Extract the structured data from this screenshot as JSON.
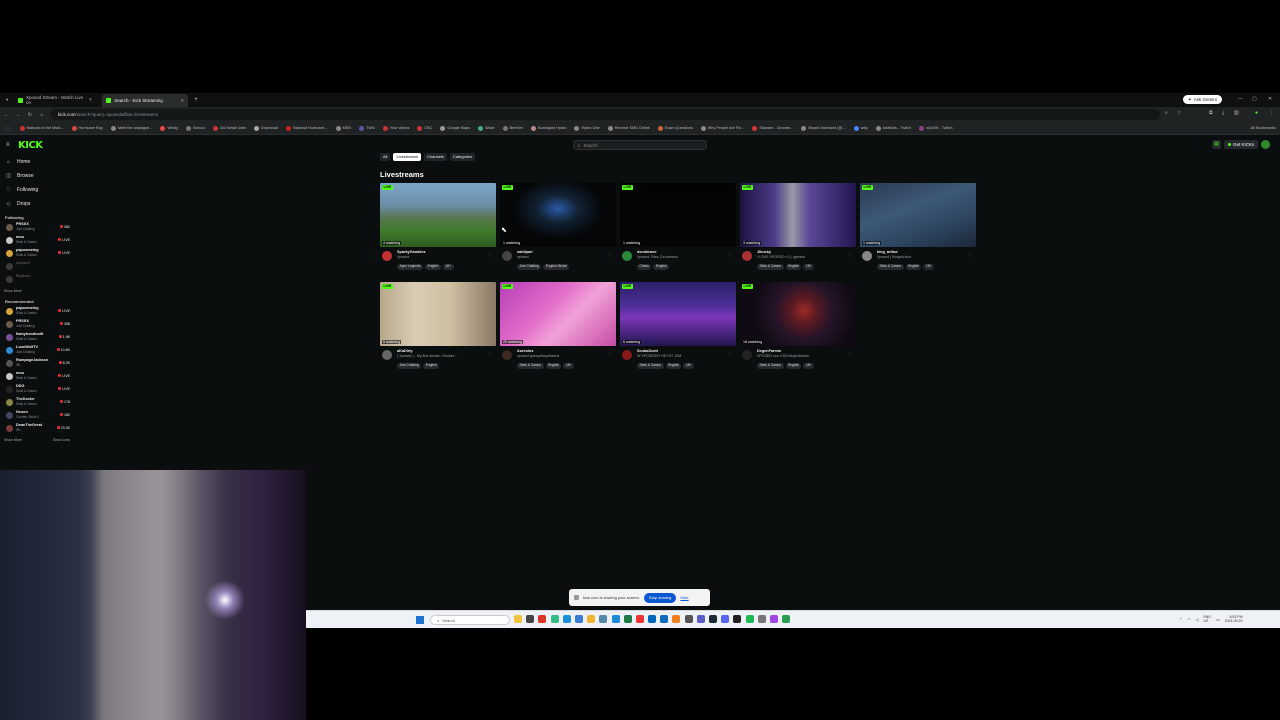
{
  "browser": {
    "tabs": [
      {
        "label": "Xposed Stream - Watch Live on"
      },
      {
        "label": "Search - Kick Streaming"
      }
    ],
    "ask_gemini": "Ask Gemini",
    "url_host": "kick.com",
    "url_path": "/search?query=xposed&filter=livestreams",
    "bookmarks": [
      "Malcolm in the Midd...",
      "Hurricane Ray",
      "Meet the analogue...",
      "Windy",
      "School",
      "444 Watch later",
      "Download",
      "National Hurricane...",
      "MSN",
      "TWN",
      "Your videos",
      "CBC",
      "Google Maps",
      "Waze",
      "BeeKen",
      "Burlington Hydro",
      "Hydro One",
      "Receive SMS Online",
      "Exam Questions",
      "Why People Are Fin...",
      "Shazam - Chrome...",
      "Bryant Moreland (@...",
      "wdq",
      "AdaBots - Twitch",
      "xQc0W - Twitch"
    ],
    "all_bookmarks": "All Bookmarks"
  },
  "kick": {
    "logo": "KICK",
    "search_placeholder": "Search",
    "get_kick": "Get KICKs",
    "sidebar": {
      "nav": [
        {
          "label": "Home",
          "icon": "home-icon"
        },
        {
          "label": "Browse",
          "icon": "browse-icon"
        },
        {
          "label": "Following",
          "icon": "heart-icon"
        },
        {
          "label": "Drops",
          "icon": "drops-icon"
        }
      ],
      "following_title": "Following",
      "following": [
        {
          "name": "PRSSX",
          "category": "Just Chatting",
          "viewers": "362",
          "color": "#6b5b4b",
          "offline": false
        },
        {
          "name": "moo",
          "category": "Slots & Casino",
          "viewers": "LIVE",
          "color": "#c9c9c9",
          "offline": false
        },
        {
          "name": "papoomeing",
          "category": "Slots & Casino",
          "viewers": "LIVE",
          "color": "#d9a23d",
          "offline": false
        },
        {
          "name": "Xposed",
          "category": "",
          "viewers": "",
          "color": "#3a3a3a",
          "offline": true
        },
        {
          "name": "Reptron",
          "category": "",
          "viewers": "",
          "color": "#3a3a3a",
          "offline": true
        }
      ],
      "show_more_following": "Show More",
      "recommended_title": "Recommended",
      "recommended": [
        {
          "name": "papoomeing",
          "category": "Slots & Casino",
          "viewers": "LIVE",
          "color": "#d9a23d"
        },
        {
          "name": "PRSSX",
          "category": "Just Chatting",
          "viewers": "358",
          "color": "#6b5b4b"
        },
        {
          "name": "flamyhoodnolit",
          "category": "Slots & Casino",
          "viewers": "1.9K",
          "color": "#7a4e9a"
        },
        {
          "name": "LoneWolfTV",
          "category": "Just Chatting",
          "viewers": "10.6K",
          "color": "#2e8bd6"
        },
        {
          "name": "RampageJackson",
          "category": "IRL",
          "viewers": "8.2K",
          "color": "#555"
        },
        {
          "name": "moo",
          "category": "Slots & Casino",
          "viewers": "LIVE",
          "color": "#c9c9c9"
        },
        {
          "name": "DDG",
          "category": "Slots & Casino",
          "viewers": "LIVE",
          "color": "#222"
        },
        {
          "name": "TheDocter",
          "category": "Slots & Casino",
          "viewers": "178",
          "color": "#884"
        },
        {
          "name": "Neoon",
          "category": "Counter-Strike 2",
          "viewers": "182",
          "color": "#446"
        },
        {
          "name": "DeanTheGreat",
          "category": "IRL",
          "viewers": "23.3K",
          "color": "#7a3b3b"
        }
      ],
      "show_more": "Show More",
      "show_less": "Show Less"
    },
    "filters": [
      {
        "label": "All",
        "active": false
      },
      {
        "label": "Livestreams",
        "active": true
      },
      {
        "label": "Channels",
        "active": false
      },
      {
        "label": "Categories",
        "active": false
      }
    ],
    "section_title": "Livestreams",
    "live_badge": "LIVE",
    "streams": [
      {
        "channel": "SparkyGamblez",
        "title": "Xposed",
        "watching": "4 watching",
        "tags": [
          "Apex Legends",
          "English",
          "18+"
        ],
        "thumb": "linear-gradient(180deg,#7aa6c9 0%,#6c8ea7 35%,#58764f 55%,#3f7b2c 75%,#2f5a20 100%)",
        "avatar": "#c03030"
      },
      {
        "channel": "sahilpari",
        "title": "xposed",
        "watching": "1 watching",
        "tags": [
          "Just Chatting",
          "English Sindal"
        ],
        "thumb": "radial-gradient(ellipse at 50% 40%,#2b5aa8 0%,#123 25%,#050608 55%)",
        "avatar": "#444"
      },
      {
        "channel": "dcunbravo",
        "title": "Xposed. Rtcs. Dcunbravo",
        "watching": "1 watching",
        "tags": [
          "Chess",
          "English"
        ],
        "thumb": "linear-gradient(180deg,#020303,#050607)",
        "avatar": "#2a8a3a"
      },
      {
        "channel": "Jlbucky",
        "title": "I LOVE XPOSED <3 | !gamba",
        "watching": "3 watching",
        "tags": [
          "Slots & Casino",
          "English",
          "18+"
        ],
        "thumb": "linear-gradient(90deg,#1d1240 0%,#4c3c88 30%,#9a98a6 45%,#5a4696 60%,#231552 100%)",
        "avatar": "#a33"
      },
      {
        "channel": "king_arthur",
        "title": "Xposed | KingxArthur",
        "watching": "1 watching",
        "tags": [
          "Slots & Casino",
          "English",
          "18+"
        ],
        "thumb": "linear-gradient(160deg,#2b3a52 0%,#3e5878 40%,#2d4560 70%,#1c2638 100%)",
        "avatar": "#888"
      },
      {
        "channel": "aKaDirty",
        "title": "( Xposed ) - My first stream. Roobet...",
        "watching": "5 watching",
        "tags": [
          "Just Chatting",
          "English"
        ],
        "thumb": "linear-gradient(90deg,#b8a88a 0%,#d8ccb4 30%,#cfc0a3 60%,#8a7a66 100%)",
        "avatar": "#666"
      },
      {
        "channel": "Aureolos",
        "title": "xposed spinsprinsprinsehz",
        "watching": "20 watching",
        "tags": [
          "Slots & Casino",
          "English",
          "18+"
        ],
        "thumb": "linear-gradient(135deg,#b43fb6 0%,#e26cc9 40%,#f2a2d8 60%,#c54aa5 100%)",
        "avatar": "#3a2a20"
      },
      {
        "channel": "ScubaScott",
        "title": "W XPOSED!!!! HE HIT 10M",
        "watching": "6 watching",
        "tags": [
          "Slots & Casino",
          "English",
          "18+"
        ],
        "thumb": "linear-gradient(180deg,#2a1f6a 0%,#4a2e96 35%,#7b36b9 55%,#21164f 100%)",
        "avatar": "#8a1a1a"
      },
      {
        "channel": "DegenFarmm",
        "title": "XPOSED vcc: KICKdegenfarmm",
        "watching": "18 watching",
        "tags": [
          "Slots & Casino",
          "English",
          "18+"
        ],
        "thumb": "radial-gradient(circle at 55% 45%,#9c2a2a 0%,#5a1a22 18%,#241428 40%,#0f0a14 70%)",
        "avatar": "#222"
      }
    ]
  },
  "share_bar": {
    "text": "kick.com is sharing your screen.",
    "stop": "Stop sharing",
    "hide": "Hide"
  },
  "taskbar": {
    "search_placeholder": "Search",
    "lang_top": "ENG",
    "lang_bottom": "US",
    "time": "5:03 PM",
    "date": "2024-09-24"
  }
}
